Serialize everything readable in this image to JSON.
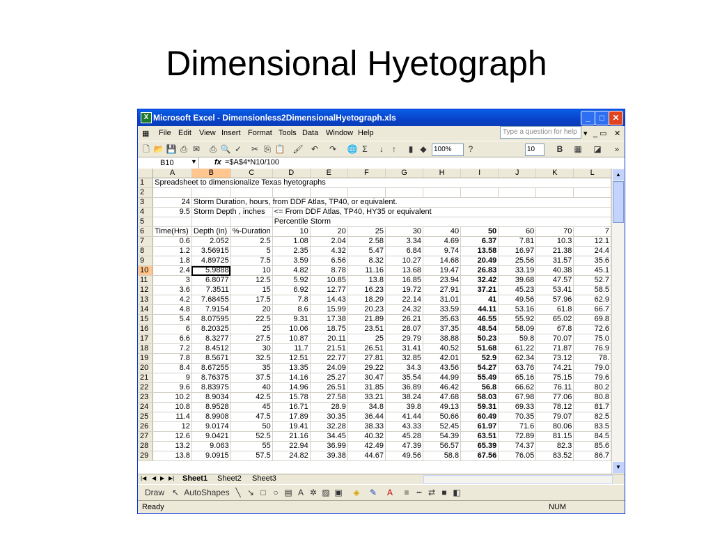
{
  "slide": {
    "title": "Dimensional Hyetograph"
  },
  "window": {
    "title": "Microsoft Excel - Dimensionless2DimensionalHyetograph.xls"
  },
  "menu": [
    "File",
    "Edit",
    "View",
    "Insert",
    "Format",
    "Tools",
    "Data",
    "Window",
    "Help"
  ],
  "ask_placeholder": "Type a question for help",
  "toolbar": {
    "zoom": "100%",
    "font_size": "10",
    "bold_label": "B"
  },
  "formula_bar": {
    "name_box": "B10",
    "formula": "=$A$4*N10/100"
  },
  "columns": [
    "A",
    "B",
    "C",
    "D",
    "E",
    "F",
    "G",
    "H",
    "I",
    "J",
    "K",
    "L"
  ],
  "sheet_text": {
    "r1": "Spreadsheet to dimensionalize Texas hyetographs",
    "r3a": "24",
    "r3b": "Storm Duration, hours, from DDF Atlas, TP40, or equivalent.",
    "r4a": "9.5",
    "r4b": "Storm Depth , inches",
    "r4c": "<= From DDF Atlas, TP40, HY35 or equivalent",
    "r5d": "Percentile Storm",
    "h_a": "Time(Hrs)",
    "h_b": "Depth (in)",
    "h_c": "%-Duration"
  },
  "percentiles": [
    "10",
    "20",
    "25",
    "30",
    "40",
    "50",
    "60",
    "70",
    "7"
  ],
  "rows": [
    {
      "n": "7",
      "v": [
        "0.6",
        "2.052",
        "2.5",
        "1.08",
        "2.04",
        "2.58",
        "3.34",
        "4.69",
        "6.37",
        "7.81",
        "10.3",
        "12.1"
      ]
    },
    {
      "n": "8",
      "v": [
        "1.2",
        "3.56915",
        "5",
        "2.35",
        "4.32",
        "5.47",
        "6.84",
        "9.74",
        "13.58",
        "16.97",
        "21.38",
        "24.4"
      ]
    },
    {
      "n": "9",
      "v": [
        "1.8",
        "4.89725",
        "7.5",
        "3.59",
        "6.56",
        "8.32",
        "10.27",
        "14.68",
        "20.49",
        "25.56",
        "31.57",
        "35.6"
      ]
    },
    {
      "n": "10",
      "v": [
        "2.4",
        "5.9888",
        "10",
        "4.82",
        "8.78",
        "11.16",
        "13.68",
        "19.47",
        "26.83",
        "33.19",
        "40.38",
        "45.1"
      ]
    },
    {
      "n": "11",
      "v": [
        "3",
        "6.8077",
        "12.5",
        "5.92",
        "10.85",
        "13.8",
        "16.85",
        "23.94",
        "32.42",
        "39.68",
        "47.57",
        "52.7"
      ]
    },
    {
      "n": "12",
      "v": [
        "3.6",
        "7.3511",
        "15",
        "6.92",
        "12.77",
        "16.23",
        "19.72",
        "27.91",
        "37.21",
        "45.23",
        "53.41",
        "58.5"
      ]
    },
    {
      "n": "13",
      "v": [
        "4.2",
        "7.68455",
        "17.5",
        "7.8",
        "14.43",
        "18.29",
        "22.14",
        "31.01",
        "41",
        "49.56",
        "57.96",
        "62.9"
      ]
    },
    {
      "n": "14",
      "v": [
        "4.8",
        "7.9154",
        "20",
        "8.6",
        "15.99",
        "20.23",
        "24.32",
        "33.59",
        "44.11",
        "53.16",
        "61.8",
        "66.7"
      ]
    },
    {
      "n": "15",
      "v": [
        "5.4",
        "8.07595",
        "22.5",
        "9.31",
        "17.38",
        "21.89",
        "26.21",
        "35.63",
        "46.55",
        "55.92",
        "65.02",
        "69.8"
      ]
    },
    {
      "n": "16",
      "v": [
        "6",
        "8.20325",
        "25",
        "10.06",
        "18.75",
        "23.51",
        "28.07",
        "37.35",
        "48.54",
        "58.09",
        "67.8",
        "72.6"
      ]
    },
    {
      "n": "17",
      "v": [
        "6.6",
        "8.3277",
        "27.5",
        "10.87",
        "20.11",
        "25",
        "29.79",
        "38.88",
        "50.23",
        "59.8",
        "70.07",
        "75.0"
      ]
    },
    {
      "n": "18",
      "v": [
        "7.2",
        "8.4512",
        "30",
        "11.7",
        "21.51",
        "26.51",
        "31.41",
        "40.52",
        "51.68",
        "61.22",
        "71.87",
        "76.9"
      ]
    },
    {
      "n": "19",
      "v": [
        "7.8",
        "8.5671",
        "32.5",
        "12.51",
        "22.77",
        "27.81",
        "32.85",
        "42.01",
        "52.9",
        "62.34",
        "73.12",
        "78."
      ]
    },
    {
      "n": "20",
      "v": [
        "8.4",
        "8.67255",
        "35",
        "13.35",
        "24.09",
        "29.22",
        "34.3",
        "43.56",
        "54.27",
        "63.76",
        "74.21",
        "79.0"
      ]
    },
    {
      "n": "21",
      "v": [
        "9",
        "8.76375",
        "37.5",
        "14.16",
        "25.27",
        "30.47",
        "35.54",
        "44.99",
        "55.49",
        "65.16",
        "75.15",
        "79.6"
      ]
    },
    {
      "n": "22",
      "v": [
        "9.6",
        "8.83975",
        "40",
        "14.96",
        "26.51",
        "31.85",
        "36.89",
        "46.42",
        "56.8",
        "66.62",
        "76.11",
        "80.2"
      ]
    },
    {
      "n": "23",
      "v": [
        "10.2",
        "8.9034",
        "42.5",
        "15.78",
        "27.58",
        "33.21",
        "38.24",
        "47.68",
        "58.03",
        "67.98",
        "77.06",
        "80.8"
      ]
    },
    {
      "n": "24",
      "v": [
        "10.8",
        "8.9528",
        "45",
        "16.71",
        "28.9",
        "34.8",
        "39.8",
        "49.13",
        "59.31",
        "69.33",
        "78.12",
        "81.7"
      ]
    },
    {
      "n": "25",
      "v": [
        "11.4",
        "8.9908",
        "47.5",
        "17.89",
        "30.35",
        "36.44",
        "41.44",
        "50.66",
        "60.49",
        "70.35",
        "79.07",
        "82.5"
      ]
    },
    {
      "n": "26",
      "v": [
        "12",
        "9.0174",
        "50",
        "19.41",
        "32.28",
        "38.33",
        "43.33",
        "52.45",
        "61.97",
        "71.6",
        "80.06",
        "83.5"
      ]
    },
    {
      "n": "27",
      "v": [
        "12.6",
        "9.0421",
        "52.5",
        "21.16",
        "34.45",
        "40.32",
        "45.28",
        "54.39",
        "63.51",
        "72.89",
        "81.15",
        "84.5"
      ]
    },
    {
      "n": "28",
      "v": [
        "13.2",
        "9.063",
        "55",
        "22.94",
        "36.99",
        "42.49",
        "47.39",
        "56.57",
        "65.39",
        "74.37",
        "82.3",
        "85.6"
      ]
    },
    {
      "n": "29",
      "v": [
        "13.8",
        "9.0915",
        "57.5",
        "24.82",
        "39.38",
        "44.67",
        "49.56",
        "58.8",
        "67.56",
        "76.05",
        "83.52",
        "86.7"
      ]
    }
  ],
  "sheets": [
    "Sheet1",
    "Sheet2",
    "Sheet3"
  ],
  "drawbar": {
    "draw": "Draw",
    "autoshapes": "AutoShapes"
  },
  "status": {
    "left": "Ready",
    "num": "NUM"
  }
}
